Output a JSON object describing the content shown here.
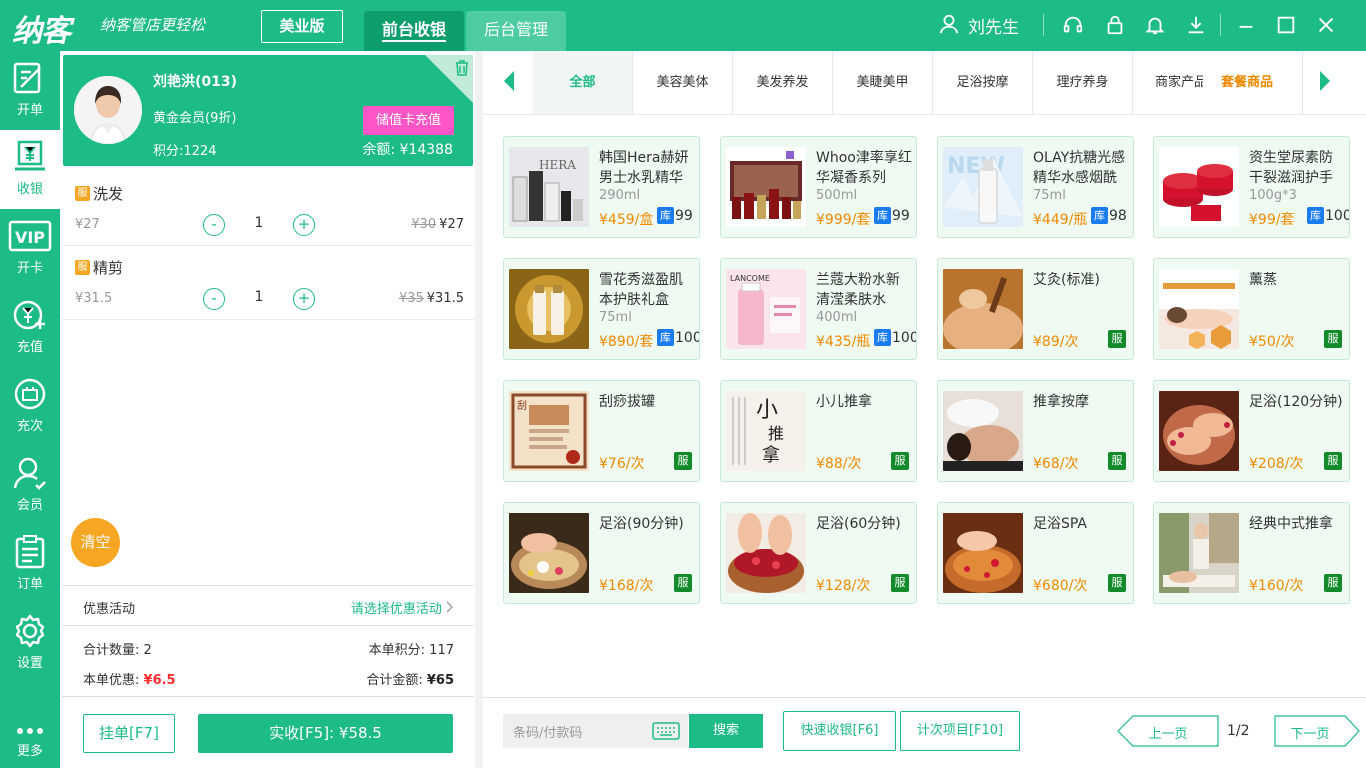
{
  "header": {
    "logo": "纳客",
    "slogan": "纳客管店更轻松",
    "edition": "美业版",
    "tabs": [
      "前台收银",
      "后台管理"
    ],
    "user": "刘先生"
  },
  "sidebar": [
    {
      "label": "开单",
      "icon": "edit-icon"
    },
    {
      "label": "收银",
      "icon": "cashier-icon"
    },
    {
      "label": "开卡",
      "icon": "vip-icon"
    },
    {
      "label": "充值",
      "icon": "recharge-icon"
    },
    {
      "label": "充次",
      "icon": "refill-count-icon"
    },
    {
      "label": "会员",
      "icon": "member-icon"
    },
    {
      "label": "订单",
      "icon": "order-icon"
    },
    {
      "label": "设置",
      "icon": "gear-icon"
    },
    {
      "label": "更多",
      "icon": "more-icon"
    }
  ],
  "member": {
    "name": "刘艳洪(013)",
    "level": "黄金会员(9折)",
    "points": "积分:1224",
    "balance": "余额: ¥14388",
    "recharge": "储值卡充值"
  },
  "cart": {
    "items": [
      {
        "tag": "服",
        "name": "洗发",
        "price": "¥27",
        "minus": "-",
        "qty": "1",
        "plus": "+",
        "orig": "¥30",
        "total": "¥27"
      },
      {
        "tag": "服",
        "name": "精剪",
        "price": "¥31.5",
        "minus": "-",
        "qty": "1",
        "plus": "+",
        "orig": "¥35",
        "total": "¥31.5"
      }
    ],
    "clear": "清空",
    "promo_label": "优惠活动",
    "promo_select": "请选择优惠活动",
    "qty_label": "合计数量:",
    "qty_value": "2",
    "points_label": "本单积分:",
    "points_value": "117",
    "discount_label": "本单优惠:",
    "discount_value": "¥6.5",
    "amount_label": "合计金额:",
    "amount_value": "¥65",
    "hang": "挂单[F7]",
    "pay": "实收[F5]: ¥58.5"
  },
  "categories": [
    "全部",
    "美容美体",
    "美发养发",
    "美睫美甲",
    "足浴按摩",
    "理疗养身",
    "商家产品",
    "套餐商品"
  ],
  "products": [
    {
      "name": "韩国Hera赫妍男士水乳精华",
      "spec": "290ml",
      "price": "¥459/盒",
      "stock_tag": "库",
      "stock": "99"
    },
    {
      "name": "Whoo津率享红华凝香系列",
      "spec": "500ml",
      "price": "¥999/套",
      "stock_tag": "库",
      "stock": "99"
    },
    {
      "name": "OLAY抗糖光感精华水感烟酰",
      "spec": "75ml",
      "price": "¥449/瓶",
      "stock_tag": "库",
      "stock": "98"
    },
    {
      "name": "资生堂尿素防干裂滋润护手",
      "spec": "100g*3",
      "price": "¥99/套",
      "stock_tag": "库",
      "stock": "100"
    },
    {
      "name": "雪花秀滋盈肌本护肤礼盒",
      "spec": "75ml",
      "price": "¥890/套",
      "stock_tag": "库",
      "stock": "100"
    },
    {
      "name": "兰蔻大粉水新清滢柔肤水",
      "spec": "400ml",
      "price": "¥435/瓶",
      "stock_tag": "库",
      "stock": "100"
    },
    {
      "name": "艾灸(标准)",
      "price": "¥89/次",
      "tag": "服"
    },
    {
      "name": "薰蒸",
      "price": "¥50/次",
      "tag": "服"
    },
    {
      "name": "刮痧拔罐",
      "price": "¥76/次",
      "tag": "服"
    },
    {
      "name": "小儿推拿",
      "price": "¥88/次",
      "tag": "服"
    },
    {
      "name": "推拿按摩",
      "price": "¥68/次",
      "tag": "服"
    },
    {
      "name": "足浴(120分钟)",
      "price": "¥208/次",
      "tag": "服"
    },
    {
      "name": "足浴(90分钟)",
      "price": "¥168/次",
      "tag": "服"
    },
    {
      "name": "足浴(60分钟)",
      "price": "¥128/次",
      "tag": "服"
    },
    {
      "name": "足浴SPA",
      "price": "¥680/次",
      "tag": "服"
    },
    {
      "name": "经典中式推拿",
      "price": "¥160/次",
      "tag": "服"
    }
  ],
  "bottom": {
    "search_placeholder": "条码/付款码",
    "search_btn": "搜索",
    "quick": "快速收银[F6]",
    "count": "计次项目[F10]",
    "prev": "上一页",
    "page": "1/2",
    "next": "下一页"
  }
}
